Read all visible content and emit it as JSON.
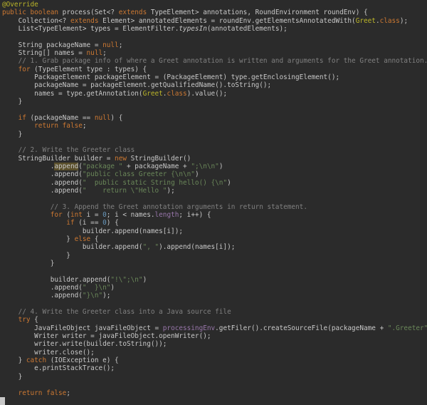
{
  "editor": {
    "language": "java",
    "theme": {
      "background": "#2b2b2b",
      "text": "#c8c8c8",
      "keyword": "#cc7832",
      "annotation": "#bbb529",
      "string": "#6a8759",
      "comment": "#808080",
      "number": "#6897bb",
      "field": "#9876aa",
      "highlight": "#5a4f2a"
    },
    "lines": [
      [
        [
          "ann",
          "@Override"
        ]
      ],
      [
        [
          "kw",
          "public boolean "
        ],
        [
          "t",
          "process(Set<? "
        ],
        [
          "kw",
          "extends "
        ],
        [
          "t",
          "TypeElement> annotations, RoundEnvironment roundEnv) {"
        ]
      ],
      [
        [
          "t",
          "    Collection<? "
        ],
        [
          "kw",
          "extends "
        ],
        [
          "t",
          "Element> annotatedElements = roundEnv.getElementsAnnotatedWith("
        ],
        [
          "ann",
          "Greet"
        ],
        [
          "t",
          "."
        ],
        [
          "kw",
          "class"
        ],
        [
          "t",
          ");"
        ]
      ],
      [
        [
          "t",
          "    List<TypeElement> types = ElementFilter."
        ],
        [
          "it",
          "typesIn"
        ],
        [
          "t",
          "(annotatedElements);"
        ]
      ],
      [
        [
          "t",
          ""
        ]
      ],
      [
        [
          "t",
          "    String packageName = "
        ],
        [
          "kw",
          "null"
        ],
        [
          "t",
          ";"
        ]
      ],
      [
        [
          "t",
          "    String[] names = "
        ],
        [
          "kw",
          "null"
        ],
        [
          "t",
          ";"
        ]
      ],
      [
        [
          "cm",
          "    // 1. Grab package info of where a Greet annotation is written and arguments for the Greet annotation."
        ]
      ],
      [
        [
          "kw",
          "    for "
        ],
        [
          "t",
          "(TypeElement type : types) {"
        ]
      ],
      [
        [
          "t",
          "        PackageElement packageElement = (PackageElement) type.getEnclosingElement();"
        ]
      ],
      [
        [
          "t",
          "        packageName = packageElement.getQualifiedName().toString();"
        ]
      ],
      [
        [
          "t",
          "        names = type.getAnnotation("
        ],
        [
          "ann",
          "Greet"
        ],
        [
          "t",
          "."
        ],
        [
          "kw",
          "class"
        ],
        [
          "t",
          ").value();"
        ]
      ],
      [
        [
          "t",
          "    }"
        ]
      ],
      [
        [
          "t",
          ""
        ]
      ],
      [
        [
          "kw",
          "    if "
        ],
        [
          "t",
          "(packageName == "
        ],
        [
          "kw",
          "null"
        ],
        [
          "t",
          ") {"
        ]
      ],
      [
        [
          "kw",
          "        return false"
        ],
        [
          "t",
          ";"
        ]
      ],
      [
        [
          "t",
          "    }"
        ]
      ],
      [
        [
          "t",
          ""
        ]
      ],
      [
        [
          "cm",
          "    // 2. Write the Greeter class"
        ]
      ],
      [
        [
          "t",
          "    StringBuilder builder = "
        ],
        [
          "kw",
          "new "
        ],
        [
          "t",
          "StringBuilder()"
        ]
      ],
      [
        [
          "t",
          "            ."
        ],
        [
          "hl",
          "append"
        ],
        [
          "t",
          "("
        ],
        [
          "str",
          "\"package \""
        ],
        [
          "t",
          " + packageName + "
        ],
        [
          "str",
          "\";\\n\\n\""
        ],
        [
          "t",
          ")"
        ]
      ],
      [
        [
          "t",
          "            .append("
        ],
        [
          "str",
          "\"public class Greeter {\\n\\n\""
        ],
        [
          "t",
          ")"
        ]
      ],
      [
        [
          "t",
          "            .append("
        ],
        [
          "str",
          "\"  public static String hello() {\\n\""
        ],
        [
          "t",
          ")"
        ]
      ],
      [
        [
          "t",
          "            .append("
        ],
        [
          "str",
          "\"    return \\\"Hello \""
        ],
        [
          "t",
          ");"
        ]
      ],
      [
        [
          "t",
          ""
        ]
      ],
      [
        [
          "cm",
          "            // 3. Append the Greet annotation arguments in return statement."
        ]
      ],
      [
        [
          "kw",
          "            for "
        ],
        [
          "t",
          "("
        ],
        [
          "kw",
          "int "
        ],
        [
          "t",
          "i = "
        ],
        [
          "num",
          "0"
        ],
        [
          "t",
          "; i < names."
        ],
        [
          "fld",
          "length"
        ],
        [
          "t",
          "; i++) {"
        ]
      ],
      [
        [
          "kw",
          "                if "
        ],
        [
          "t",
          "(i == "
        ],
        [
          "num",
          "0"
        ],
        [
          "t",
          ") {"
        ]
      ],
      [
        [
          "t",
          "                    builder.append(names[i]);"
        ]
      ],
      [
        [
          "t",
          "                } "
        ],
        [
          "kw",
          "else "
        ],
        [
          "t",
          "{"
        ]
      ],
      [
        [
          "t",
          "                    builder.append("
        ],
        [
          "str",
          "\", \""
        ],
        [
          "t",
          ").append(names[i]);"
        ]
      ],
      [
        [
          "t",
          "                }"
        ]
      ],
      [
        [
          "t",
          "            }"
        ]
      ],
      [
        [
          "t",
          ""
        ]
      ],
      [
        [
          "t",
          "            builder.append("
        ],
        [
          "str",
          "\"!\\\";\\n\""
        ],
        [
          "t",
          ")"
        ]
      ],
      [
        [
          "t",
          "            .append("
        ],
        [
          "str",
          "\"  }\\n\""
        ],
        [
          "t",
          ")"
        ]
      ],
      [
        [
          "t",
          "            .append("
        ],
        [
          "str",
          "\"}\\n\""
        ],
        [
          "t",
          ");"
        ]
      ],
      [
        [
          "t",
          ""
        ]
      ],
      [
        [
          "cm",
          "    // 4. Write the Greeter class into a Java source file"
        ]
      ],
      [
        [
          "kw",
          "    try "
        ],
        [
          "t",
          "{"
        ]
      ],
      [
        [
          "t",
          "        JavaFileObject javaFileObject = "
        ],
        [
          "fld",
          "processingEnv"
        ],
        [
          "t",
          ".getFiler().createSourceFile(packageName + "
        ],
        [
          "str",
          "\".Greeter\""
        ],
        [
          "t",
          ");"
        ]
      ],
      [
        [
          "t",
          "        Writer writer = javaFileObject.openWriter();"
        ]
      ],
      [
        [
          "t",
          "        writer.write(builder.toString());"
        ]
      ],
      [
        [
          "t",
          "        writer.close();"
        ]
      ],
      [
        [
          "t",
          "    } "
        ],
        [
          "kw",
          "catch "
        ],
        [
          "t",
          "(IOException e) {"
        ]
      ],
      [
        [
          "t",
          "        e.printStackTrace();"
        ]
      ],
      [
        [
          "t",
          "    }"
        ]
      ],
      [
        [
          "t",
          ""
        ]
      ],
      [
        [
          "kw",
          "    return false"
        ],
        [
          "t",
          ";"
        ]
      ],
      [
        [
          "t",
          ""
        ]
      ]
    ]
  }
}
